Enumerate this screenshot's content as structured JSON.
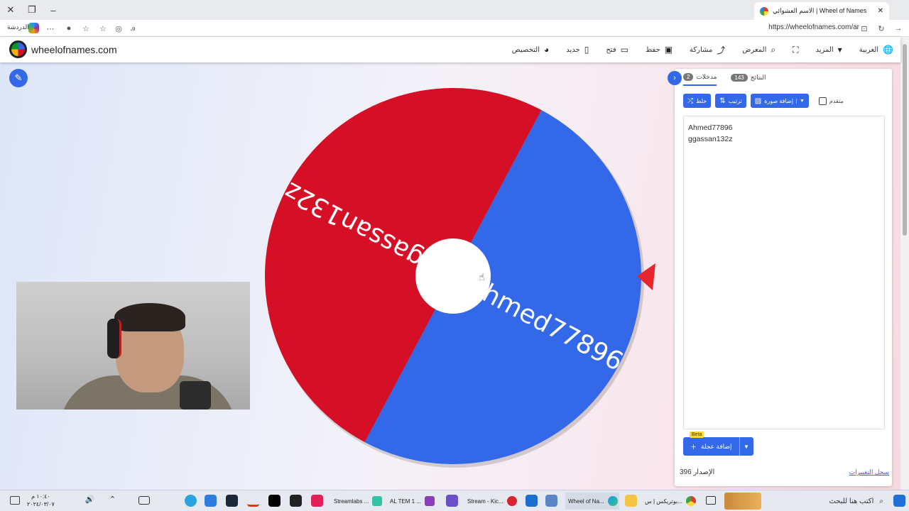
{
  "browser": {
    "tab_title": "الاسم العشوائي | Wheel of Names",
    "url": "https://wheelofnames.com/ar",
    "copilot_label": "الدردشة"
  },
  "site": {
    "name": "wheelofnames.com",
    "menu": [
      {
        "label": "العربية",
        "icon": "globe-icon",
        "glyph": "🌐"
      },
      {
        "label": "المزيد",
        "icon": "chevron-down-icon",
        "glyph": "▾"
      },
      {
        "label": "",
        "icon": "fullscreen-icon",
        "glyph": "⛶"
      },
      {
        "label": "المعرض",
        "icon": "search-icon",
        "glyph": "⌕"
      },
      {
        "label": "مشاركة",
        "icon": "share-icon",
        "glyph": "⤴"
      },
      {
        "label": "حفظ",
        "icon": "save-icon",
        "glyph": "▣"
      },
      {
        "label": "فتح",
        "icon": "folder-icon",
        "glyph": "▭"
      },
      {
        "label": "جديد",
        "icon": "new-file-icon",
        "glyph": "▯"
      },
      {
        "label": "التخصيص",
        "icon": "palette-icon",
        "glyph": "◕"
      }
    ]
  },
  "wheel": {
    "segments": [
      {
        "label": "Ahmed77896",
        "color": "#3369e8"
      },
      {
        "label": "ggassan132z",
        "color": "#d50f25"
      }
    ],
    "pointer_color": "#e8242f"
  },
  "panel": {
    "tabs": [
      {
        "label": "مدخلات",
        "count": "2"
      },
      {
        "label": "النتائج",
        "count": "143"
      }
    ],
    "toolbar": {
      "shuffle": "خلط",
      "sort": "ترتيب",
      "add_image": "إضافة صورة",
      "advanced": "متقدم"
    },
    "entries": [
      "Ahmed77896",
      "ggassan132z"
    ],
    "add_wheel": "إضافة عجلة",
    "beta": "Beta",
    "version": "الإصدار 396",
    "changelog": "سجل التغييرات"
  },
  "taskbar": {
    "time": "١٠:٤٠ م",
    "date": "٢٠٢٤/٠٣/٠٧",
    "search_placeholder": "اكتب هنا للبحث",
    "apps": [
      "Streamlabs ...",
      "AL TEM 1 ...",
      "Stream - Kic...",
      "Wheel of Na...",
      "بوتريكس | س..."
    ]
  },
  "colors": {
    "accent": "#3369e8",
    "red": "#d50f25"
  }
}
